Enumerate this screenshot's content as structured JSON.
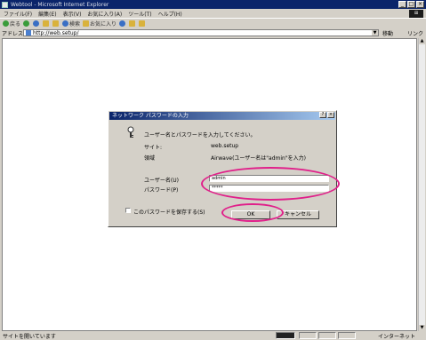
{
  "window": {
    "title": "Webtool - Microsoft Internet Explorer",
    "controls": [
      "_",
      "□",
      "×"
    ]
  },
  "menu": [
    "ファイル(F)",
    "編集(E)",
    "表示(V)",
    "お気に入り(A)",
    "ツール(T)",
    "ヘルプ(H)"
  ],
  "toolbar": {
    "back": "戻る",
    "search": "検索",
    "favorites": "お気に入り"
  },
  "address": {
    "label": "アドレス(D)",
    "url": "http://web.setup/",
    "go": "移動",
    "links": "リンク"
  },
  "dialog": {
    "title": "ネットワーク パスワードの入力",
    "prompt": "ユーザー名とパスワードを入力してください。",
    "site_label": "サイト:",
    "site_value": "web.setup",
    "realm_label": "領域",
    "realm_value": "Airwave(ユーザー名は\"admin\"を入力)",
    "username_label": "ユーザー名(U)",
    "username_value": "admin",
    "password_label": "パスワード(P)",
    "password_value": "*****",
    "save_password_label": "このパスワードを保存する(S)",
    "ok_label": "OK",
    "cancel_label": "キャンセル"
  },
  "status": {
    "text": "サイトを開いています",
    "zone": "インターネット"
  },
  "colors": {
    "title_blue": "#0a246a",
    "highlight": "#e0208a"
  }
}
